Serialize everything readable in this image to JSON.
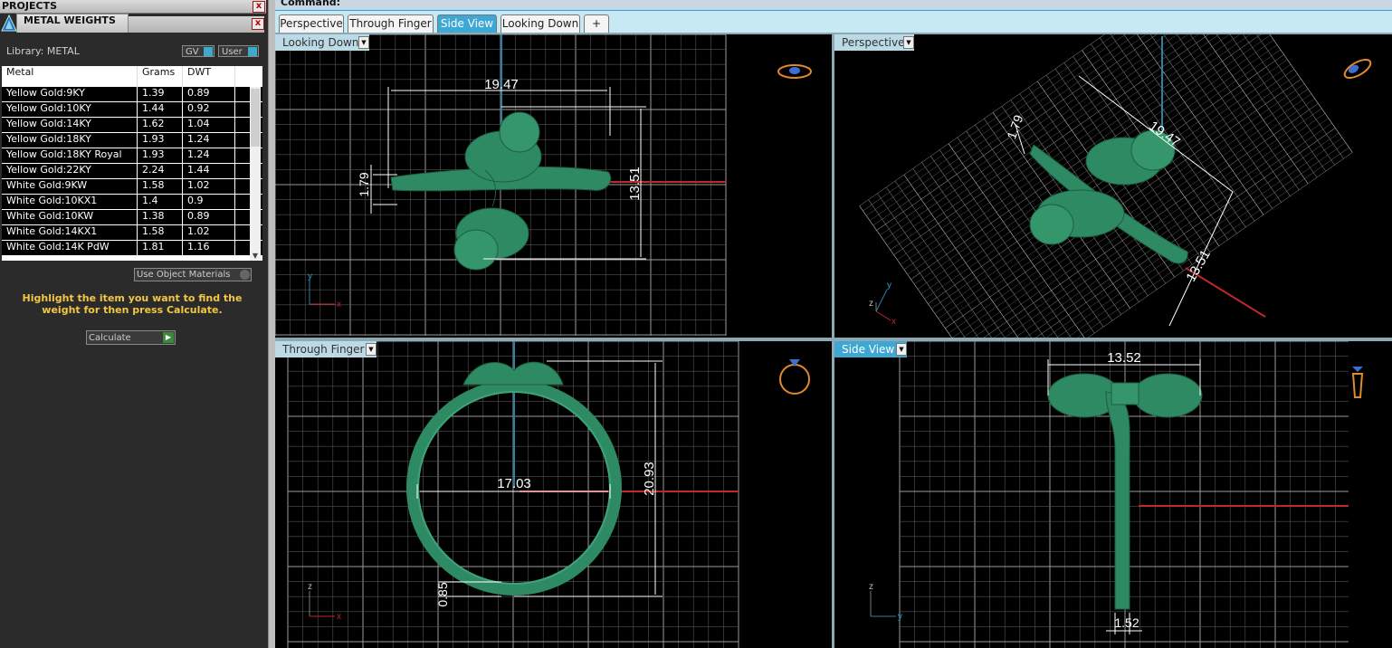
{
  "panel": {
    "projects_title": "PROJECTS",
    "close_label": "x",
    "metal_weights_title": "METAL WEIGHTS",
    "library_label": "Library: METAL",
    "toggle_gv": "GV",
    "toggle_user": "User",
    "use_object_materials": "Use Object Materials",
    "hint": "Highlight the item you want to find the weight for then press Calculate.",
    "calculate_label": "Calculate"
  },
  "table": {
    "headers": [
      "Metal",
      "Grams",
      "DWT"
    ],
    "rows": [
      [
        "Yellow Gold:9KY",
        "1.39",
        "0.89"
      ],
      [
        "Yellow Gold:10KY",
        "1.44",
        "0.92"
      ],
      [
        "Yellow Gold:14KY",
        "1.62",
        "1.04"
      ],
      [
        "Yellow Gold:18KY",
        "1.93",
        "1.24"
      ],
      [
        "Yellow Gold:18KY Royal",
        "1.93",
        "1.24"
      ],
      [
        "Yellow Gold:22KY",
        "2.24",
        "1.44"
      ],
      [
        "White Gold:9KW",
        "1.58",
        "1.02"
      ],
      [
        "White Gold:10KX1",
        "1.4",
        "0.9"
      ],
      [
        "White Gold:10KW",
        "1.38",
        "0.89"
      ],
      [
        "White Gold:14KX1",
        "1.58",
        "1.02"
      ],
      [
        "White Gold:14K PdW",
        "1.81",
        "1.16"
      ]
    ]
  },
  "command_label": "Command:",
  "tabs": [
    {
      "label": "Perspective",
      "active": false
    },
    {
      "label": "Through Finger",
      "active": false
    },
    {
      "label": "Side View",
      "active": true
    },
    {
      "label": "Looking Down",
      "active": false
    }
  ],
  "add_tab_label": "+",
  "viewports": {
    "looking_down": {
      "label": "Looking Down",
      "dim_width": "19.47",
      "dim_height": "13.51",
      "dim_band": "1.79",
      "axis_x": "x",
      "axis_y": "y"
    },
    "perspective": {
      "label": "Perspective",
      "dim_width": "19.47",
      "dim_height": "13.51",
      "dim_band": "1.79",
      "axis_x": "x",
      "axis_y": "y",
      "axis_z": "z"
    },
    "through_finger": {
      "label": "Through Finger",
      "dim_inner": "17.03",
      "dim_height": "20.93",
      "dim_band": "0.85",
      "axis_x": "x",
      "axis_z": "z"
    },
    "side_view": {
      "label": "Side View",
      "dim_width": "13.52",
      "dim_band": "1.52",
      "axis_y": "y",
      "axis_z": "z"
    }
  },
  "colors": {
    "accent": "#3fa7d4",
    "model": "#2e8a63",
    "hint_text": "#f2c744",
    "axis_red": "#c0282b",
    "axis_blue": "#2e7fa0"
  }
}
